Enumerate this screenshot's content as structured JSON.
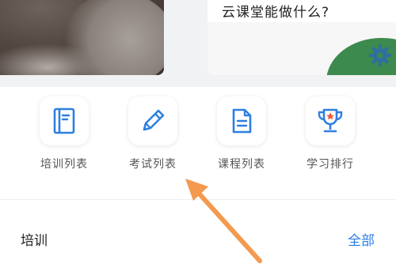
{
  "banner": {
    "card_title": "云课堂能做什么?"
  },
  "menu": {
    "items": [
      {
        "label": "培训列表",
        "icon": "training-book-icon"
      },
      {
        "label": "考试列表",
        "icon": "pencil-icon"
      },
      {
        "label": "课程列表",
        "icon": "document-icon"
      },
      {
        "label": "学习排行",
        "icon": "trophy-icon"
      }
    ]
  },
  "section": {
    "title": "培训",
    "more_label": "全部"
  },
  "colors": {
    "accent": "#2b7de9",
    "icon_blue": "#2f7fe0",
    "trophy_star": "#f05a3a",
    "arrow": "#f39a4f"
  }
}
